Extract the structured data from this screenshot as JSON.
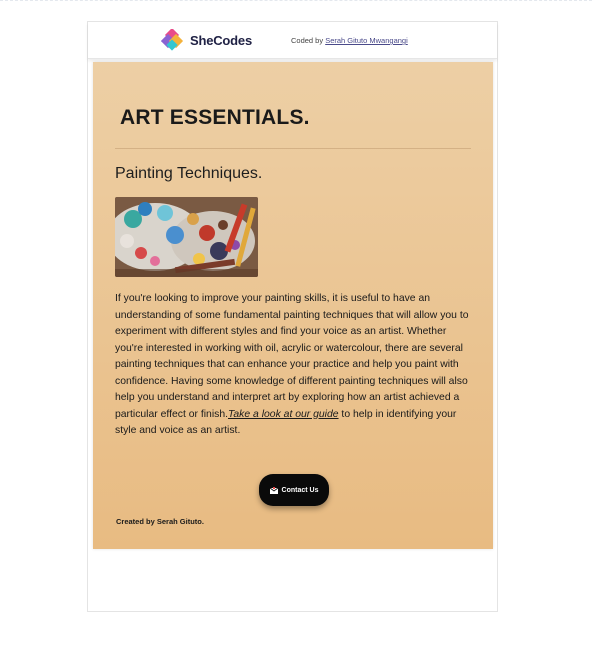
{
  "header": {
    "logo_text": "SheCodes",
    "coded_by_prefix": "Coded by ",
    "coded_by_name": "Serah Gituto Mwangangi"
  },
  "main": {
    "title": "ART ESSENTIALS.",
    "subtitle": "Painting Techniques.",
    "body_text": "If you're looking to improve your painting skills, it is useful to have an understanding of some fundamental painting techniques that will allow you to experiment with different styles and find your voice as an artist. Whether you're interested in working with oil, acrylic or watercolour, there are several painting techniques that can enhance your practice and help you paint with confidence. Having some knowledge of different painting techniques will also help you understand and interpret art by exploring how an artist achieved a particular effect or finish.",
    "link_text": "Take a look at our guide",
    "body_text_end": " to help in identifying your style and voice as an artist.",
    "contact_button": "Contact Us",
    "created_by": "Created by Serah Gituto."
  },
  "colors": {
    "gradient_top": "#edcfa5",
    "gradient_bottom": "#e8bb82",
    "button_bg": "#0a0a0a"
  },
  "icons": {
    "logo": "shecodes-logo-icon",
    "contact": "mail-icon"
  }
}
